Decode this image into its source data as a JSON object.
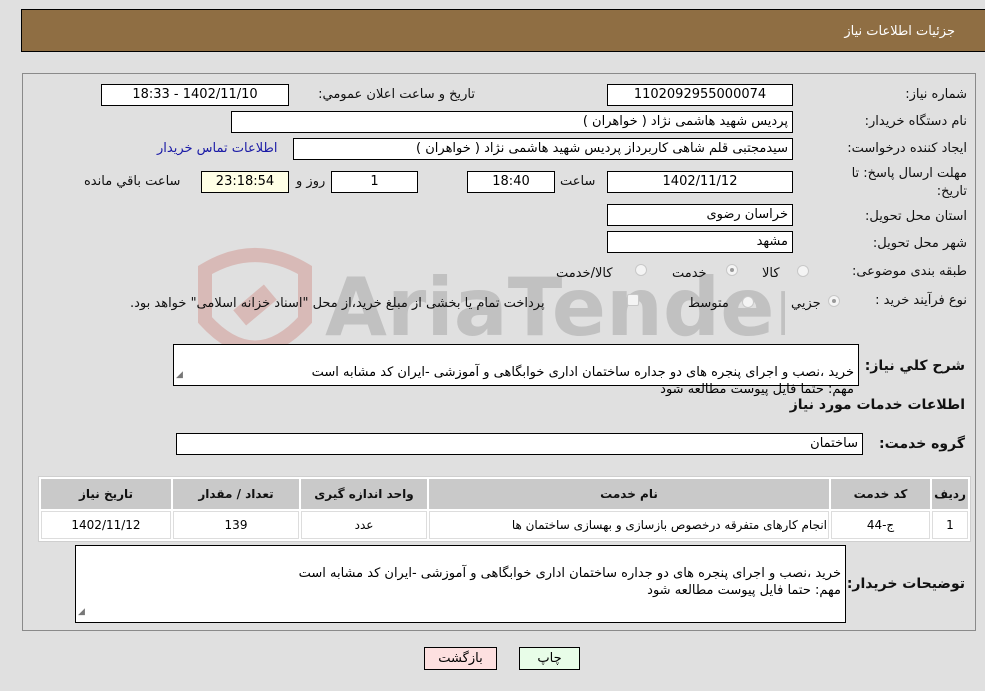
{
  "header": {
    "title": "جزئیات اطلاعات نیاز"
  },
  "fields": {
    "need_number": {
      "label": "شماره نیاز:",
      "value": "1102092955000074"
    },
    "announce": {
      "label": "تاریخ و ساعت اعلان عمومي:",
      "value": "1402/11/10 - 18:33"
    },
    "buyer_org": {
      "label": "نام دستگاه خریدار:",
      "value": "پردیس شهید هاشمی نژاد ( خواهران )"
    },
    "requester": {
      "label": "ایجاد کننده درخواست:",
      "value": "سیدمجتبی قلم شاهی کاربرداز پردیس شهید هاشمی نژاد ( خواهران )"
    },
    "contact_link": "اطلاعات تماس خریدار",
    "deadline": {
      "label_line1": "مهلت ارسال پاسخ: تا",
      "label_line2": "تاریخ:",
      "date": "1402/11/12",
      "time_label": "ساعت",
      "time": "18:40",
      "days": "1",
      "days_label": "روز و",
      "remaining": "23:18:54",
      "remaining_label": "ساعت باقي مانده"
    },
    "province": {
      "label": "استان محل تحویل:",
      "value": "خراسان رضوی"
    },
    "city": {
      "label": "شهر محل تحویل:",
      "value": "مشهد"
    },
    "category": {
      "label": "طبقه بندی موضوعی:",
      "options": [
        "کالا",
        "خدمت",
        "کالا/خدمت"
      ],
      "selected": "خدمت"
    },
    "process": {
      "label": "نوع فرآیند خرید :",
      "options": [
        "جزيي",
        "متوسط"
      ],
      "selected": "جزيي",
      "treasury_note": "پرداخت تمام یا بخشی از مبلغ خرید،از محل \"اسناد خزانه اسلامی\" خواهد بود.",
      "treasury_checked": false
    }
  },
  "description": {
    "label": "شرح کلي نیاز:",
    "value": "خرید ،نصب و اجرای پنجره های دو جداره ساختمان اداری خوابگاهی و آموزشی -ایران کد مشابه است\nمهم: حتما فایل پیوست مطالعه شود"
  },
  "services_section": {
    "title": "اطلاعات خدمات مورد نیاز"
  },
  "service_group": {
    "label": "گروه خدمت:",
    "value": "ساختمان"
  },
  "table": {
    "headers": [
      "ردیف",
      "کد خدمت",
      "نام خدمت",
      "واحد اندازه گیری",
      "تعداد / مقدار",
      "تاریخ نیاز"
    ],
    "rows": [
      [
        "1",
        "ج-44",
        "انجام کارهای متفرقه درخصوص بازسازی و بهسازی ساختمان ها",
        "عدد",
        "139",
        "1402/11/12"
      ]
    ]
  },
  "buyer_notes": {
    "label": "توضیحات خریدار:",
    "value": "خرید ،نصب و اجرای پنجره های دو جداره ساختمان اداری خوابگاهی و آموزشی -ایران کد مشابه است\nمهم: حتما فایل پیوست مطالعه شود"
  },
  "buttons": {
    "print": "چاپ",
    "back": "بازگشت"
  },
  "colors": {
    "header_bg": "#8f6e43",
    "print_bg": "#e8fde8",
    "back_bg": "#fde0e0",
    "link": "#1a1aa6"
  }
}
